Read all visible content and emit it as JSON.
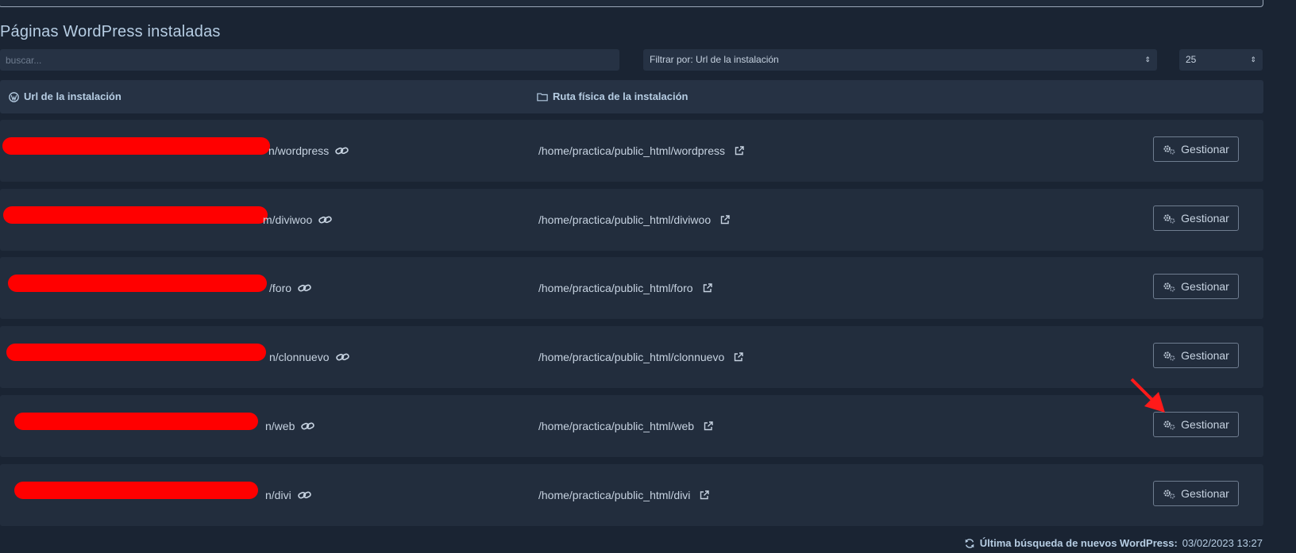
{
  "page": {
    "title": "Páginas WordPress instaladas"
  },
  "toolbar": {
    "search_placeholder": "buscar...",
    "filter_label": "Filtrar por: Url de la instalación",
    "per_page": "25"
  },
  "table": {
    "headers": {
      "url": "Url de la instalación",
      "path": "Ruta física de la instalación"
    },
    "rows": [
      {
        "url_suffix": "n/wordpress",
        "path": "/home/practica/public_html/wordpress",
        "action": "Gestionar"
      },
      {
        "url_suffix": "m/diviwoo",
        "path": "/home/practica/public_html/diviwoo",
        "action": "Gestionar"
      },
      {
        "url_suffix": "/foro",
        "path": "/home/practica/public_html/foro",
        "action": "Gestionar"
      },
      {
        "url_suffix": "n/clonnuevo",
        "path": "/home/practica/public_html/clonnuevo",
        "action": "Gestionar"
      },
      {
        "url_suffix": "n/web",
        "path": "/home/practica/public_html/web",
        "action": "Gestionar"
      },
      {
        "url_suffix": "n/divi",
        "path": "/home/practica/public_html/divi",
        "action": "Gestionar"
      }
    ]
  },
  "footer": {
    "label": "Última búsqueda de nuevos WordPress:",
    "timestamp": "03/02/2023 13:27"
  },
  "icons": {
    "header_url": "wordpress-icon",
    "header_path": "folder-icon",
    "url_link": "link-icon",
    "path_link": "external-link-icon",
    "manage": "gears-icon",
    "footer": "refresh-icon"
  },
  "colors": {
    "background": "#1a2433",
    "row": "#222d3d",
    "redaction": "#ff0000",
    "annotation_arrow": "#ff0000"
  }
}
